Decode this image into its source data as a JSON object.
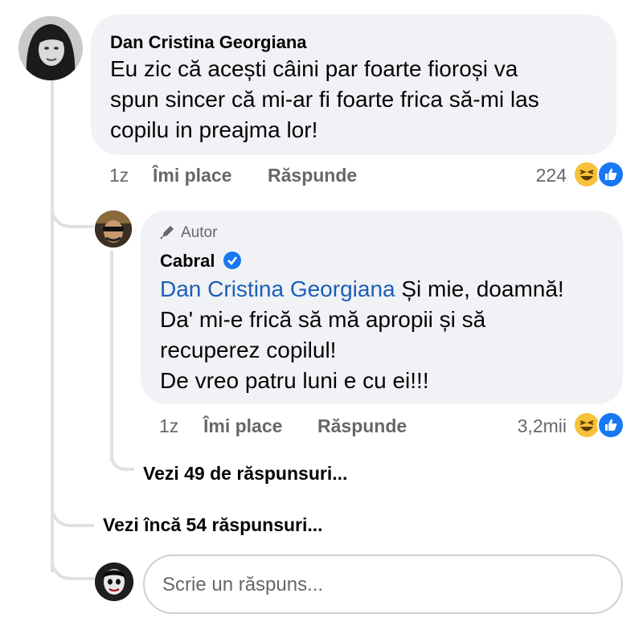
{
  "comment": {
    "author": "Dan Cristina Georgiana",
    "text": "Eu zic că acești câini par foarte fioroși va\nspun sincer că mi-ar fi foarte frica să-mi las\ncopilu in preajma lor!",
    "time": "1z",
    "like_label": "Îmi place",
    "reply_label": "Răspunde",
    "reaction_count": "224",
    "reactions": [
      "haha-icon",
      "like-icon"
    ]
  },
  "reply": {
    "badge": "Autor",
    "author": "Cabral",
    "verified": true,
    "mention": "Dan Cristina Georgiana",
    "text_first_line_rest": " Și mie, doamnă!",
    "text_rest": "Da' mi-e frică să mă apropii și să\nrecuperez copilul!\nDe vreo patru luni e cu ei!!!",
    "time": "1z",
    "like_label": "Îmi place",
    "reply_label": "Răspunde",
    "reaction_count": "3,2mii",
    "reactions": [
      "haha-icon",
      "like-icon"
    ]
  },
  "links": {
    "view_replies": "Vezi 49 de răspunsuri...",
    "view_more": "Vezi încă 54 răspunsuri..."
  },
  "composer": {
    "placeholder": "Scrie un răspuns..."
  },
  "colors": {
    "bubble": "#f0f2f5",
    "meta": "#65676b",
    "mention": "#1c5fb8",
    "verified": "#1877f2",
    "like": "#1877f2",
    "haha": "#f7c13a"
  }
}
